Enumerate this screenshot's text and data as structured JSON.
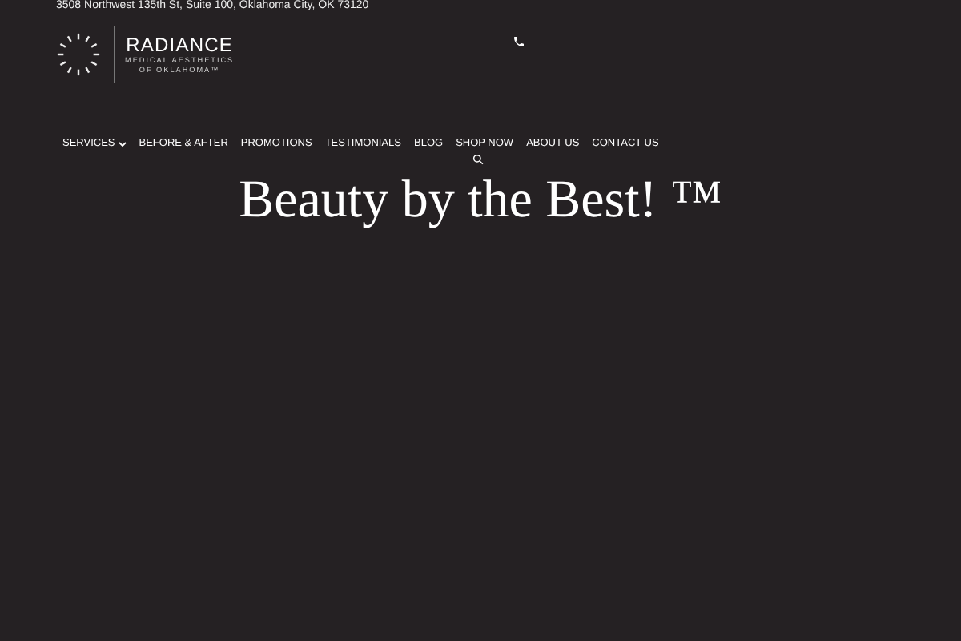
{
  "top_bar": {
    "address": "3508 Northwest 135th St, Suite 100, Oklahoma City, OK 73120"
  },
  "logo": {
    "name": "RADIANCE",
    "subtitle_line_1": "MEDICAL AESTHETICS",
    "subtitle_line_2": "OF OKLAHOMA™"
  },
  "nav": {
    "items": [
      {
        "label": "SERVICES",
        "has_dropdown": true
      },
      {
        "label": "BEFORE & AFTER",
        "has_dropdown": false
      },
      {
        "label": "PROMOTIONS",
        "has_dropdown": false
      },
      {
        "label": "TESTIMONIALS",
        "has_dropdown": false
      },
      {
        "label": "BLOG",
        "has_dropdown": false
      },
      {
        "label": "SHOP NOW",
        "has_dropdown": false
      },
      {
        "label": "ABOUT US",
        "has_dropdown": false
      },
      {
        "label": "CONTACT US",
        "has_dropdown": false
      }
    ]
  },
  "hero": {
    "heading": "Beauty by the Best! ™"
  }
}
